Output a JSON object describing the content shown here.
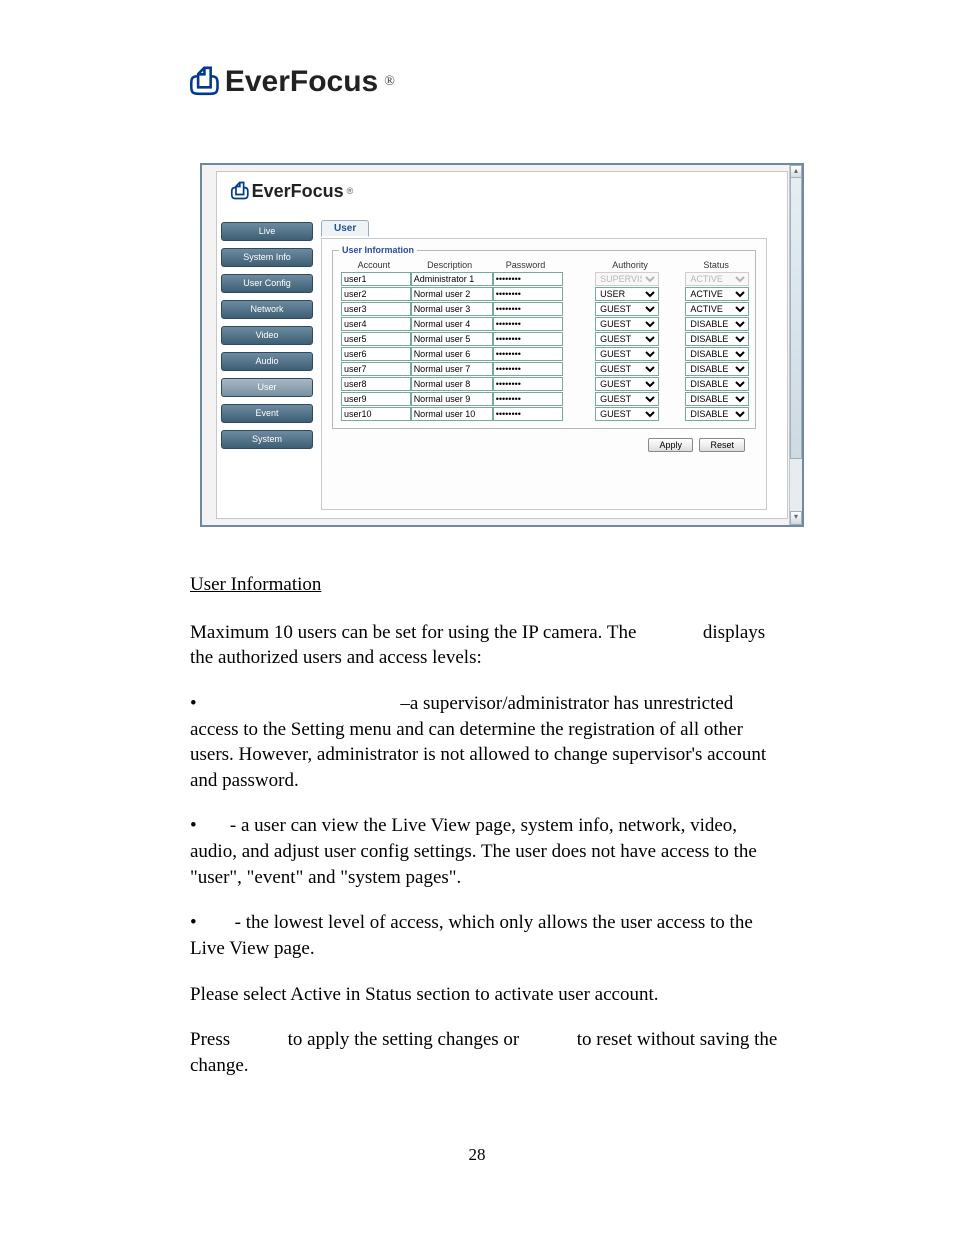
{
  "brand": {
    "glyph": "⎙",
    "name": "EverFocus",
    "registered": "®"
  },
  "screenshot": {
    "tab_label": "User",
    "legend": "User Information",
    "sidebar_items": [
      "Live",
      "System Info",
      "User Config",
      "Network",
      "Video",
      "Audio",
      "User",
      "Event",
      "System"
    ],
    "sidebar_selected_index": 6,
    "columns": [
      "Account",
      "Description",
      "Password",
      "Authority",
      "Status"
    ],
    "rows": [
      {
        "account": "user1",
        "desc": "Administrator 1",
        "pwd": "********",
        "auth": "SUPERVISOR",
        "auth_disabled": true,
        "status": "ACTIVE",
        "status_disabled": true
      },
      {
        "account": "user2",
        "desc": "Normal user 2",
        "pwd": "********",
        "auth": "USER",
        "auth_disabled": false,
        "status": "ACTIVE",
        "status_disabled": false
      },
      {
        "account": "user3",
        "desc": "Normal user 3",
        "pwd": "********",
        "auth": "GUEST",
        "auth_disabled": false,
        "status": "ACTIVE",
        "status_disabled": false
      },
      {
        "account": "user4",
        "desc": "Normal user 4",
        "pwd": "********",
        "auth": "GUEST",
        "auth_disabled": false,
        "status": "DISABLE",
        "status_disabled": false
      },
      {
        "account": "user5",
        "desc": "Normal user 5",
        "pwd": "********",
        "auth": "GUEST",
        "auth_disabled": false,
        "status": "DISABLE",
        "status_disabled": false
      },
      {
        "account": "user6",
        "desc": "Normal user 6",
        "pwd": "********",
        "auth": "GUEST",
        "auth_disabled": false,
        "status": "DISABLE",
        "status_disabled": false
      },
      {
        "account": "user7",
        "desc": "Normal user 7",
        "pwd": "********",
        "auth": "GUEST",
        "auth_disabled": false,
        "status": "DISABLE",
        "status_disabled": false
      },
      {
        "account": "user8",
        "desc": "Normal user 8",
        "pwd": "********",
        "auth": "GUEST",
        "auth_disabled": false,
        "status": "DISABLE",
        "status_disabled": false
      },
      {
        "account": "user9",
        "desc": "Normal user 9",
        "pwd": "********",
        "auth": "GUEST",
        "auth_disabled": false,
        "status": "DISABLE",
        "status_disabled": false
      },
      {
        "account": "user10",
        "desc": "Normal user 10",
        "pwd": "********",
        "auth": "GUEST",
        "auth_disabled": false,
        "status": "DISABLE",
        "status_disabled": false
      }
    ],
    "apply_label": "Apply",
    "reset_label": "Reset"
  },
  "doc": {
    "heading": "User Information",
    "p_intro_a": "Maximum 10 users can be set for using the IP camera. The",
    "p_intro_b": "displays the authorized users and access levels:",
    "b1_lead": "•",
    "b1_rest": "–a supervisor/administrator has unrestricted access to the Setting menu and can determine the registration of all other users. However, administrator is not allowed to change supervisor's account and password.",
    "b2_lead": "•",
    "b2_rest": "- a user can view the Live View page, system info, network, video, audio, and adjust user config settings. The user does not have access to the \"user\", \"event\" and \"system pages\".",
    "b3_lead": "•",
    "b3_rest": "- the lowest level of access, which only allows the user access to the Live View page.",
    "note": "Please select Active in Status section to activate user account.",
    "press_a": "Press",
    "press_b": "to apply the setting changes or",
    "press_c": "to reset without saving the change.",
    "page_number": "28"
  }
}
